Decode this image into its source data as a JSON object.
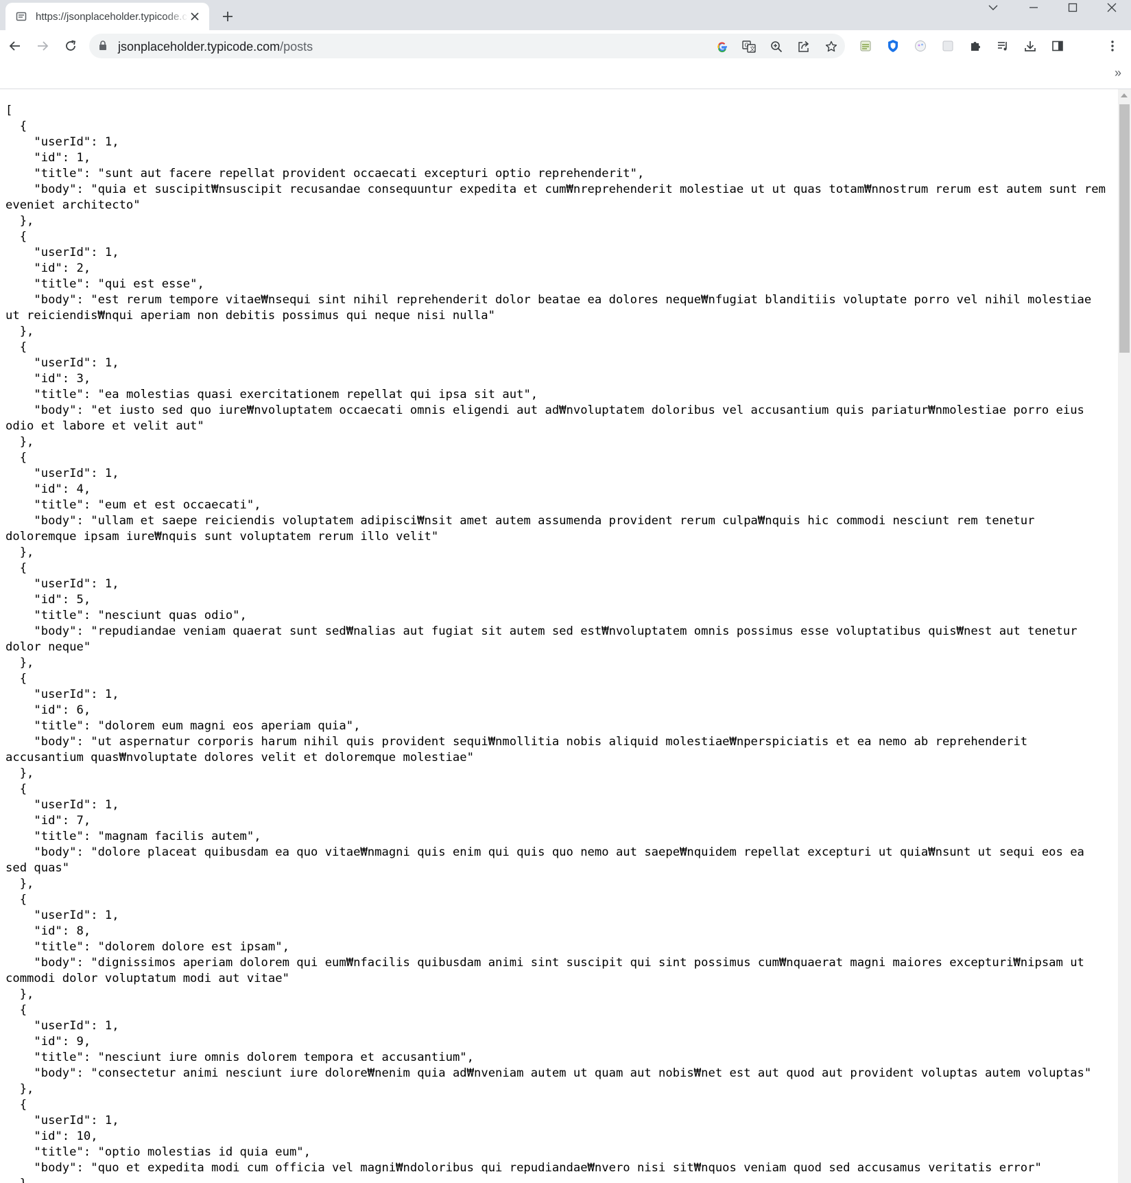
{
  "tab": {
    "title": "https://jsonplaceholder.typicode.com/posts",
    "favicon": "page-info-icon"
  },
  "toolbar": {
    "url_host": "jsonplaceholder.typicode.com",
    "url_path": "/posts"
  },
  "icons": {
    "back": "back-arrow-icon",
    "forward": "forward-arrow-icon",
    "reload": "reload-icon",
    "google": "google-icon",
    "translate": "translate-icon",
    "zoom": "zoom-icon",
    "share": "share-icon",
    "bookmark": "star-icon",
    "menu": "kebab-menu-icon"
  },
  "colors": {
    "tabstrip": "#dee1e6",
    "omnibox": "#f1f3f4",
    "text": "#000000"
  },
  "bookmarks": {
    "overflow": "»"
  },
  "posts": [
    {
      "userId": 1,
      "id": 1,
      "title": "sunt aut facere repellat provident occaecati excepturi optio reprehenderit",
      "body": "quia et suscipit₩nsuscipit recusandae consequuntur expedita et cum₩nreprehenderit molestiae ut ut quas totam₩nnostrum rerum est autem sunt rem eveniet architecto"
    },
    {
      "userId": 1,
      "id": 2,
      "title": "qui est esse",
      "body": "est rerum tempore vitae₩nsequi sint nihil reprehenderit dolor beatae ea dolores neque₩nfugiat blanditiis voluptate porro vel nihil molestiae ut reiciendis₩nqui aperiam non debitis possimus qui neque nisi nulla"
    },
    {
      "userId": 1,
      "id": 3,
      "title": "ea molestias quasi exercitationem repellat qui ipsa sit aut",
      "body": "et iusto sed quo iure₩nvoluptatem occaecati omnis eligendi aut ad₩nvoluptatem doloribus vel accusantium quis pariatur₩nmolestiae porro eius odio et labore et velit aut"
    },
    {
      "userId": 1,
      "id": 4,
      "title": "eum et est occaecati",
      "body": "ullam et saepe reiciendis voluptatem adipisci₩nsit amet autem assumenda provident rerum culpa₩nquis hic commodi nesciunt rem tenetur doloremque ipsam iure₩nquis sunt voluptatem rerum illo velit"
    },
    {
      "userId": 1,
      "id": 5,
      "title": "nesciunt quas odio",
      "body": "repudiandae veniam quaerat sunt sed₩nalias aut fugiat sit autem sed est₩nvoluptatem omnis possimus esse voluptatibus quis₩nest aut tenetur dolor neque"
    },
    {
      "userId": 1,
      "id": 6,
      "title": "dolorem eum magni eos aperiam quia",
      "body": "ut aspernatur corporis harum nihil quis provident sequi₩nmollitia nobis aliquid molestiae₩nperspiciatis et ea nemo ab reprehenderit accusantium quas₩nvoluptate dolores velit et doloremque molestiae"
    },
    {
      "userId": 1,
      "id": 7,
      "title": "magnam facilis autem",
      "body": "dolore placeat quibusdam ea quo vitae₩nmagni quis enim qui quis quo nemo aut saepe₩nquidem repellat excepturi ut quia₩nsunt ut sequi eos ea sed quas"
    },
    {
      "userId": 1,
      "id": 8,
      "title": "dolorem dolore est ipsam",
      "body": "dignissimos aperiam dolorem qui eum₩nfacilis quibusdam animi sint suscipit qui sint possimus cum₩nquaerat magni maiores excepturi₩nipsam ut commodi dolor voluptatum modi aut vitae"
    },
    {
      "userId": 1,
      "id": 9,
      "title": "nesciunt iure omnis dolorem tempora et accusantium",
      "body": "consectetur animi nesciunt iure dolore₩nenim quia ad₩nveniam autem ut quam aut nobis₩net est aut quod aut provident voluptas autem voluptas"
    },
    {
      "userId": 1,
      "id": 10,
      "title": "optio molestias id quia eum",
      "body": "quo et expedita modi cum officia vel magni₩ndoloribus qui repudiandae₩nvero nisi sit₩nquos veniam quod sed accusamus veritatis error"
    }
  ]
}
